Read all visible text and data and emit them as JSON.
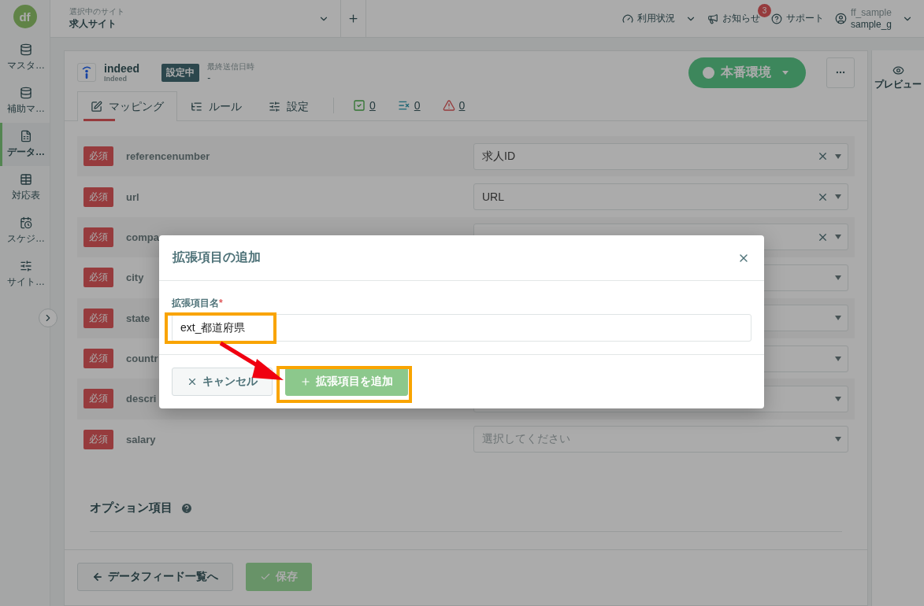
{
  "logo": "df",
  "sidebar": {
    "items": [
      {
        "kind": "master",
        "label": "マスタ…",
        "selected": false
      },
      {
        "kind": "aux",
        "label": "補助マ…",
        "selected": false
      },
      {
        "kind": "data",
        "label": "データ…",
        "selected": true
      },
      {
        "kind": "table",
        "label": "対応表",
        "selected": false
      },
      {
        "kind": "schedule",
        "label": "スケジ…",
        "selected": false
      },
      {
        "kind": "site",
        "label": "サイト…",
        "selected": false
      }
    ]
  },
  "topbar": {
    "site_caption": "選択中のサイト",
    "site_name": "求人サイト",
    "menu": [
      {
        "kind": "usage",
        "label": "利用状況"
      },
      {
        "kind": "news",
        "label": "お知らせ",
        "badge": "3"
      },
      {
        "kind": "support",
        "label": "サポート"
      }
    ],
    "user": {
      "account": "ff_sample",
      "name": "sample_g"
    }
  },
  "feed": {
    "name": "indeed",
    "subname": "Indeed",
    "status": "設定中",
    "last_sent_label": "最終送信日時",
    "last_sent": "-",
    "environment": "本番環境"
  },
  "tabs": [
    {
      "kind": "mapping",
      "label": "マッピング",
      "selected": true
    },
    {
      "kind": "rule",
      "label": "ルール",
      "selected": false
    },
    {
      "kind": "settings",
      "label": "設定",
      "selected": false
    }
  ],
  "counters": [
    {
      "kind": "valid",
      "value": "0"
    },
    {
      "kind": "excluded",
      "value": "0"
    },
    {
      "kind": "error",
      "value": "0"
    }
  ],
  "rows": [
    {
      "badge": "必須",
      "name": "referencenumber",
      "value": "求人ID",
      "clearable": true
    },
    {
      "badge": "必須",
      "name": "url",
      "value": "URL",
      "clearable": true
    },
    {
      "badge": "必須",
      "name": "compa",
      "clearable": true
    },
    {
      "badge": "必須",
      "name": "city",
      "clearable": false
    },
    {
      "badge": "必須",
      "name": "state",
      "clearable": false
    },
    {
      "badge": "必須",
      "name": "countr",
      "clearable": false
    },
    {
      "badge": "必須",
      "name": "descri",
      "clearable": false
    },
    {
      "badge": "必須",
      "name": "salary",
      "placeholder": "選択してください",
      "clearable": false
    }
  ],
  "optional_section": "オプション項目",
  "footer": {
    "back": "データフィード一覧へ",
    "save": "保存"
  },
  "preview": "プレビュー",
  "modal": {
    "title": "拡張項目の追加",
    "field_label": "拡張項目名",
    "required_mark": "*",
    "value": "ext_都道府県",
    "buttons": [
      {
        "kind": "cancel",
        "label": "キャンセル"
      },
      {
        "kind": "add",
        "label": "拡張項目を追加"
      }
    ]
  }
}
